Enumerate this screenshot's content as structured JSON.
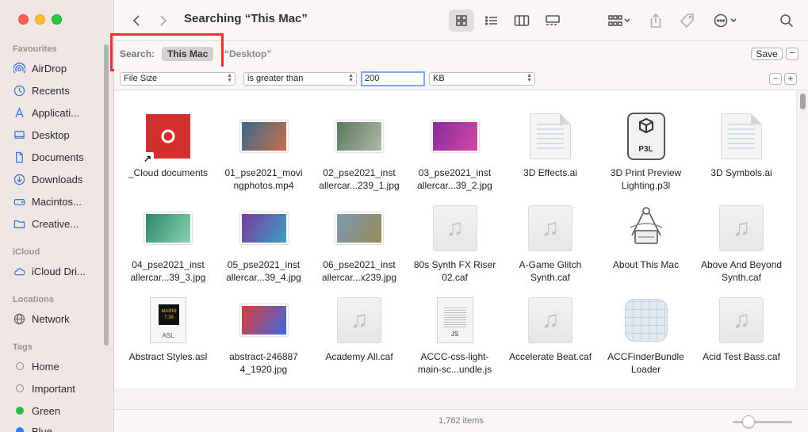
{
  "window": {
    "title": "Searching “This Mac”"
  },
  "sidebar": {
    "favourites_header": "Favourites",
    "favourites": [
      {
        "label": "AirDrop",
        "icon": "airdrop-icon"
      },
      {
        "label": "Recents",
        "icon": "clock-icon"
      },
      {
        "label": "Applicati...",
        "icon": "applications-icon"
      },
      {
        "label": "Desktop",
        "icon": "desktop-icon"
      },
      {
        "label": "Documents",
        "icon": "document-icon"
      },
      {
        "label": "Downloads",
        "icon": "download-icon"
      },
      {
        "label": "Macintos...",
        "icon": "disk-icon"
      },
      {
        "label": "Creative...",
        "icon": "folder-icon"
      }
    ],
    "icloud_header": "iCloud",
    "icloud": [
      {
        "label": "iCloud Dri...",
        "icon": "cloud-icon"
      }
    ],
    "locations_header": "Locations",
    "locations": [
      {
        "label": "Network",
        "icon": "network-icon"
      }
    ],
    "tags_header": "Tags",
    "tags": [
      {
        "label": "Home",
        "color": "none"
      },
      {
        "label": "Important",
        "color": "none"
      },
      {
        "label": "Green",
        "color": "#2fb84a"
      },
      {
        "label": "Blue",
        "color": "#2f7ff5"
      }
    ]
  },
  "search": {
    "scope_label": "Search:",
    "scope_selected": "This Mac",
    "scope_other": "“Desktop”",
    "save_label": "Save",
    "remove_label": "−",
    "criteria": {
      "attribute": "File Size",
      "operator": "is greater than",
      "value": "200",
      "unit": "KB",
      "remove_label": "−",
      "add_label": "+"
    }
  },
  "files": [
    {
      "name": "_Cloud documents",
      "type": "cc"
    },
    {
      "name": "01_pse2021_movingphotos.mp4",
      "type": "photo",
      "label": "01_pse2021_movi ngphotos.mp4",
      "colors": [
        "#3a6a8a",
        "#c96e4a"
      ]
    },
    {
      "name": "02_pse2021_installercar...239_1.jpg",
      "type": "photo",
      "label": "02_pse2021_inst allercar...239_1.jpg",
      "colors": [
        "#5a7a5a",
        "#b0b8a8"
      ]
    },
    {
      "name": "03_pse2021_installercar...39_2.jpg",
      "type": "photo",
      "label": "03_pse2021_inst allercar...39_2.jpg",
      "colors": [
        "#8a2aa0",
        "#d04aa0"
      ]
    },
    {
      "name": "3D Effects.ai",
      "type": "doc"
    },
    {
      "name": "3D Print Preview Lighting.p3l",
      "type": "p3l",
      "badge": "P3L"
    },
    {
      "name": "3D Symbols.ai",
      "type": "doc"
    },
    {
      "name": "04_pse2021_installercar...39_3.jpg",
      "type": "photo",
      "label": "04_pse2021_inst allercar...39_3.jpg",
      "colors": [
        "#2a8a6a",
        "#8ad0b0"
      ]
    },
    {
      "name": "05_pse2021_installercar...39_4.jpg",
      "type": "photo",
      "label": "05_pse2021_inst allercar...39_4.jpg",
      "colors": [
        "#7a3aa0",
        "#3aa0c0"
      ]
    },
    {
      "name": "06_pse2021_installercar...x239.jpg",
      "type": "photo",
      "label": "06_pse2021_inst allercar...x239.jpg",
      "colors": [
        "#7a9ab0",
        "#9a8a5a"
      ]
    },
    {
      "name": "80s Synth FX Riser 02.caf",
      "type": "audio"
    },
    {
      "name": "A-Game Glitch Synth.caf",
      "type": "audio"
    },
    {
      "name": "About This Mac",
      "type": "app"
    },
    {
      "name": "Above And Beyond Synth.caf",
      "type": "audio"
    },
    {
      "name": "Abstract Styles.asl",
      "type": "asl",
      "badge": "ASL",
      "inner": "MARNI 7:36"
    },
    {
      "name": "abstract-2468874_1920.jpg",
      "type": "photo",
      "label": "abstract-246887 4_1920.jpg",
      "colors": [
        "#e03a3a",
        "#3a6ae0"
      ]
    },
    {
      "name": "Academy All.caf",
      "type": "audio"
    },
    {
      "name": "ACCC-css-light-main-sc...undle.js",
      "type": "js",
      "badge": "JS",
      "label": "ACCC-css-light- main-sc...undle.js"
    },
    {
      "name": "Accelerate Beat.caf",
      "type": "audio"
    },
    {
      "name": "ACCFinderBundle Loader",
      "type": "bundle"
    },
    {
      "name": "Acid Test Bass.caf",
      "type": "audio"
    }
  ],
  "status": {
    "item_count": "1,782 items"
  },
  "toolbar": {
    "icons": [
      "back-icon",
      "forward-icon",
      "icon-view-icon",
      "list-view-icon",
      "column-view-icon",
      "gallery-view-icon",
      "group-icon",
      "share-icon",
      "tag-icon",
      "more-icon",
      "search-icon"
    ]
  },
  "accent_colors": {
    "highlight_box": "#e8322a",
    "tag_green": "#2fb84a",
    "tag_blue": "#2f7ff5"
  }
}
